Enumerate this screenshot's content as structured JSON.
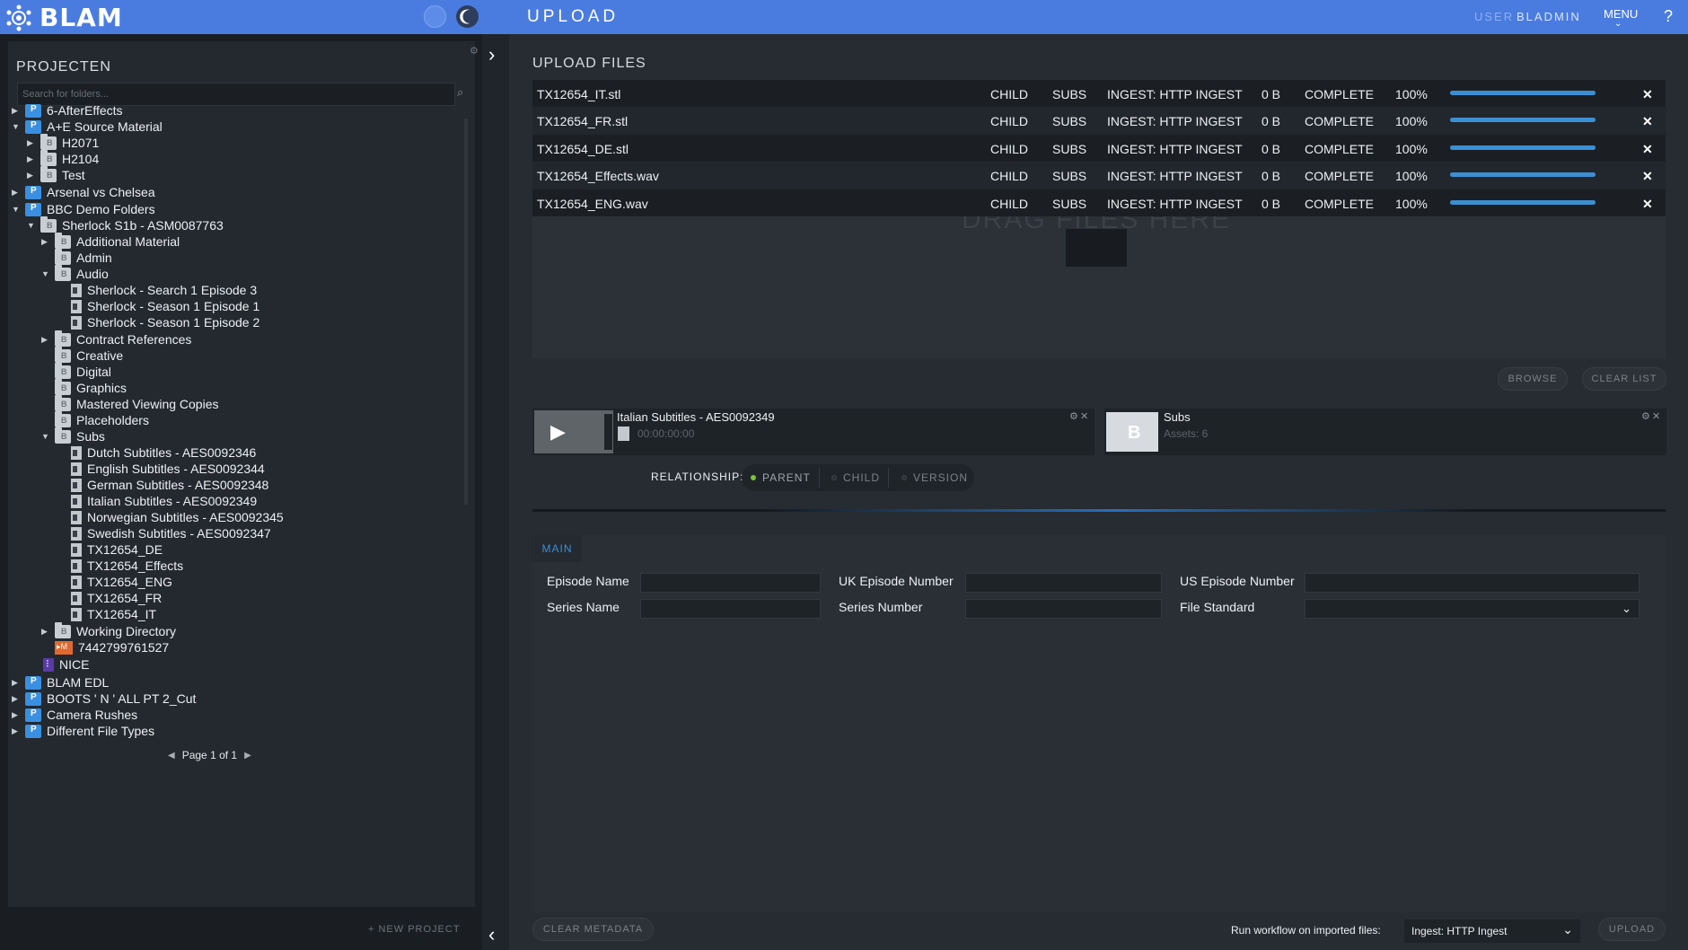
{
  "header": {
    "logo": "BLAM",
    "page_title": "UPLOAD",
    "user_label": "USER",
    "user_name": "BLADMIN",
    "menu_label": "MENU",
    "help_glyph": "?",
    "colors": {
      "bar": "#4a7ce0",
      "accent": "#3a8fd4"
    },
    "icons": [
      "logo-gear-icon",
      "settings-icon",
      "dark-mode-moon-icon",
      "help-icon"
    ]
  },
  "sidebar": {
    "title": "PROJECTEN",
    "search_placeholder": "Search for folders...",
    "tree": [
      {
        "label": "6-AfterEffects",
        "type": "project",
        "arrow": "▶",
        "depth": 0
      },
      {
        "label": "A+E Source Material",
        "type": "project",
        "arrow": "▼",
        "depth": 0
      },
      {
        "label": "H2071",
        "type": "folder",
        "arrow": "▶",
        "depth": 1
      },
      {
        "label": "H2104",
        "type": "folder",
        "arrow": "▶",
        "depth": 1
      },
      {
        "label": "Test",
        "type": "folder",
        "arrow": "▶",
        "depth": 1
      },
      {
        "label": "Arsenal vs Chelsea",
        "type": "project",
        "arrow": "▶",
        "depth": 0
      },
      {
        "label": "BBC Demo Folders",
        "type": "project",
        "arrow": "▼",
        "depth": 0
      },
      {
        "label": "Sherlock S1b - ASM0087763",
        "type": "folder",
        "arrow": "▼",
        "depth": 1
      },
      {
        "label": "Additional Material",
        "type": "folder",
        "arrow": "▶",
        "depth": 2
      },
      {
        "label": "Admin",
        "type": "folder",
        "arrow": "",
        "depth": 2
      },
      {
        "label": "Audio",
        "type": "folder",
        "arrow": "▼",
        "depth": 2
      },
      {
        "label": "Sherlock - Search 1 Episode 3",
        "type": "file",
        "arrow": "",
        "depth": 3
      },
      {
        "label": "Sherlock - Season 1 Episode 1",
        "type": "file",
        "arrow": "",
        "depth": 3
      },
      {
        "label": "Sherlock - Season 1 Episode 2",
        "type": "file",
        "arrow": "",
        "depth": 3
      },
      {
        "label": "Contract References",
        "type": "folder",
        "arrow": "▶",
        "depth": 2
      },
      {
        "label": "Creative",
        "type": "folder",
        "arrow": "",
        "depth": 2
      },
      {
        "label": "Digital",
        "type": "folder",
        "arrow": "",
        "depth": 2
      },
      {
        "label": "Graphics",
        "type": "folder",
        "arrow": "",
        "depth": 2
      },
      {
        "label": "Mastered Viewing Copies",
        "type": "folder",
        "arrow": "",
        "depth": 2
      },
      {
        "label": "Placeholders",
        "type": "folder",
        "arrow": "",
        "depth": 2
      },
      {
        "label": "Subs",
        "type": "folder",
        "arrow": "▼",
        "depth": 2
      },
      {
        "label": "Dutch Subtitles - AES0092346",
        "type": "file",
        "arrow": "",
        "depth": 3
      },
      {
        "label": "English Subtitles - AES0092344",
        "type": "file",
        "arrow": "",
        "depth": 3
      },
      {
        "label": "German Subtitles - AES0092348",
        "type": "file",
        "arrow": "",
        "depth": 3
      },
      {
        "label": "Italian Subtitles - AES0092349",
        "type": "file",
        "arrow": "",
        "depth": 3
      },
      {
        "label": "Norwegian Subtitles - AES0092345",
        "type": "file",
        "arrow": "",
        "depth": 3
      },
      {
        "label": "Swedish Subtitles - AES0092347",
        "type": "file",
        "arrow": "",
        "depth": 3
      },
      {
        "label": "TX12654_DE",
        "type": "file",
        "arrow": "",
        "depth": 3
      },
      {
        "label": "TX12654_Effects",
        "type": "file",
        "arrow": "",
        "depth": 3
      },
      {
        "label": "TX12654_ENG",
        "type": "file",
        "arrow": "",
        "depth": 3
      },
      {
        "label": "TX12654_FR",
        "type": "file",
        "arrow": "",
        "depth": 3
      },
      {
        "label": "TX12654_IT",
        "type": "file",
        "arrow": "",
        "depth": 3
      },
      {
        "label": "Working Directory",
        "type": "folder",
        "arrow": "▶",
        "depth": 2
      },
      {
        "label": "7442799761527",
        "type": "media",
        "arrow": "",
        "depth": 2
      },
      {
        "label": "NICE",
        "type": "nice",
        "arrow": "",
        "depth": 1
      },
      {
        "label": "BLAM EDL",
        "type": "project",
        "arrow": "▶",
        "depth": 0
      },
      {
        "label": "BOOTS ' N ' ALL PT 2_Cut",
        "type": "project",
        "arrow": "▶",
        "depth": 0
      },
      {
        "label": "Camera Rushes",
        "type": "project",
        "arrow": "▶",
        "depth": 0
      },
      {
        "label": "Different File Types",
        "type": "project",
        "arrow": "▶",
        "depth": 0
      }
    ],
    "pager": "Page 1 of 1",
    "pager_prev": "◀",
    "pager_next": "▶",
    "new_project": "+ NEW PROJECT"
  },
  "upload": {
    "title": "UPLOAD FILES",
    "files": [
      {
        "name": "TX12654_IT.stl",
        "type": "CHILD",
        "category": "SUBS",
        "workflow": "INGEST: HTTP INGEST",
        "size": "0 B",
        "status": "COMPLETE",
        "percent": "100%",
        "progress": 1.0
      },
      {
        "name": "TX12654_FR.stl",
        "type": "CHILD",
        "category": "SUBS",
        "workflow": "INGEST: HTTP INGEST",
        "size": "0 B",
        "status": "COMPLETE",
        "percent": "100%",
        "progress": 1.0
      },
      {
        "name": "TX12654_DE.stl",
        "type": "CHILD",
        "category": "SUBS",
        "workflow": "INGEST: HTTP INGEST",
        "size": "0 B",
        "status": "COMPLETE",
        "percent": "100%",
        "progress": 1.0
      },
      {
        "name": "TX12654_Effects.wav",
        "type": "CHILD",
        "category": "SUBS",
        "workflow": "INGEST: HTTP INGEST",
        "size": "0 B",
        "status": "COMPLETE",
        "percent": "100%",
        "progress": 1.0
      },
      {
        "name": "TX12654_ENG.wav",
        "type": "CHILD",
        "category": "SUBS",
        "workflow": "INGEST: HTTP INGEST",
        "size": "0 B",
        "status": "COMPLETE",
        "percent": "100%",
        "progress": 1.0
      }
    ],
    "remove_glyph": "✕",
    "drop_text": "DRAG FILES HERE",
    "browse_label": "BROWSE",
    "clear_list_label": "CLEAR LIST"
  },
  "assets": {
    "parent_asset": {
      "title": "Italian Subtitles - AES0092349",
      "timecode": "00:00:00:00"
    },
    "target_folder": {
      "title": "Subs",
      "count": "Assets: 6"
    },
    "control_glyphs": {
      "settings": "⚙",
      "close": "✕"
    }
  },
  "relationship": {
    "label": "RELATIONSHIP:",
    "options": [
      {
        "label": "PARENT",
        "active": true
      },
      {
        "label": "CHILD",
        "active": false
      },
      {
        "label": "VERSION",
        "active": false
      }
    ]
  },
  "metadata": {
    "tab": "MAIN",
    "fields": {
      "episode_name": {
        "label": "Episode Name",
        "value": ""
      },
      "uk_episode_number": {
        "label": "UK Episode Number",
        "value": ""
      },
      "us_episode_number": {
        "label": "US Episode Number",
        "value": ""
      },
      "series_name": {
        "label": "Series Name",
        "value": ""
      },
      "series_number": {
        "label": "Series Number",
        "value": ""
      },
      "file_standard": {
        "label": "File Standard",
        "value": ""
      }
    }
  },
  "footer": {
    "clear_metadata": "CLEAR METADATA",
    "workflow_label": "Run workflow on imported files:",
    "workflow_value": "Ingest: HTTP Ingest",
    "upload_label": "UPLOAD"
  }
}
